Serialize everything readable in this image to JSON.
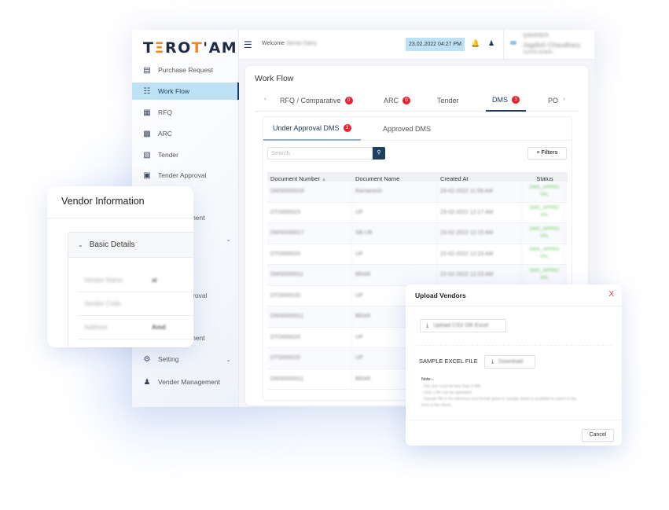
{
  "brand": {
    "logo_text_1": "T",
    "logo_accent_1": "Ξ",
    "logo_text_2": "RO",
    "logo_accent_2": "T",
    "logo_text_3": "'AM",
    "accent_color": "#f08a24",
    "primary_color": "#1f3a5f"
  },
  "sidebar": {
    "items": [
      {
        "label": "Purchase Request",
        "icon": "purchase-request-icon",
        "active": false
      },
      {
        "label": "Work Flow",
        "icon": "workflow-icon",
        "active": true
      },
      {
        "label": "RFQ",
        "icon": "rfq-icon",
        "active": false
      },
      {
        "label": "ARC",
        "icon": "arc-icon",
        "active": false
      },
      {
        "label": "Tender",
        "icon": "tender-icon",
        "active": false
      },
      {
        "label": "Tender Approval",
        "icon": "tender-approval-icon",
        "active": false
      },
      {
        "label": "ement",
        "icon": "",
        "active": false
      },
      {
        "label": "roval",
        "icon": "",
        "active": false
      },
      {
        "label": "ement",
        "icon": "",
        "active": false
      },
      {
        "label": "Setting",
        "icon": "settings-icon",
        "active": false
      },
      {
        "label": "Vender Management",
        "icon": "vendor-management-icon",
        "active": false
      }
    ]
  },
  "topbar": {
    "welcome_label": "Welcome",
    "welcome_name": "Sense Darry",
    "datetime": "23.02.2022 04:27 PM",
    "user_line1": "Q4040923",
    "user_name": "Jagdish Chaudhary",
    "user_role": "SUPER ADMIN"
  },
  "workflow": {
    "title": "Work Flow",
    "tabs": [
      {
        "label": "RFQ / Comparative",
        "badge": "0"
      },
      {
        "label": "ARC",
        "badge": "0"
      },
      {
        "label": "Tender",
        "badge": ""
      },
      {
        "label": "DMS",
        "badge": "3"
      },
      {
        "label": "PO",
        "badge": ""
      }
    ],
    "active_tab": "DMS",
    "subtabs": [
      {
        "label": "Under Approval DMS",
        "badge": "3"
      },
      {
        "label": "Approved DMS",
        "badge": ""
      }
    ],
    "search_placeholder": "Search",
    "filters_label": "Filters",
    "table": {
      "columns": [
        "Document Number",
        "Document Name",
        "Created At",
        "Status"
      ],
      "rows": [
        [
          "DMS0000018",
          "Ramanesh",
          "23-02-2022 11:59 AM",
          "DMS_APPRO VAL"
        ],
        [
          "DTO000023",
          "UP",
          "23-02-2022 12:17 AM",
          "DMS_APPRO VAL"
        ],
        [
          "DMS0000017",
          "SB-UB",
          "23-02-2022 12:15 AM",
          "DMS_APPRO VAL"
        ],
        [
          "DTO000020",
          "UP",
          "22-02-2022 12:23 AM",
          "DMS_APPRO VAL"
        ],
        [
          "DMS0000011",
          "BRAR",
          "22-02-2022 12:23 AM",
          "DMS_APPRO VAL"
        ],
        [
          "DTO000020",
          "UP",
          "",
          ""
        ],
        [
          "DMS0000011",
          "BRAR",
          "",
          ""
        ],
        [
          "DTO000020",
          "UP",
          "",
          ""
        ],
        [
          "DTO000020",
          "UP",
          "",
          ""
        ],
        [
          "DMS0000011",
          "BRAR",
          "",
          ""
        ]
      ]
    }
  },
  "vendor_info": {
    "title": "Vendor Information",
    "section_title": "Basic Details",
    "fields": [
      {
        "key": "Vendor Name",
        "value": "ai"
      },
      {
        "key": "Vendor Code",
        "value": ""
      },
      {
        "key": "Address",
        "value": "Amd"
      }
    ]
  },
  "upload_modal": {
    "title": "Upload Vendors",
    "close_label": "X",
    "upload_label": "Upload CSV OR Excel",
    "sample_label": "SAMPLE EXCEL FILE",
    "download_label": "Download",
    "note_label": "Note:-",
    "notes": [
      "- File size must be less than 5 MB.",
      "- Only 1 file can be uploaded.",
      "- Sample file is for reference and format given in sample sheet is available to select in the",
      "  form in the sheet."
    ],
    "cancel_label": "Cancel"
  }
}
